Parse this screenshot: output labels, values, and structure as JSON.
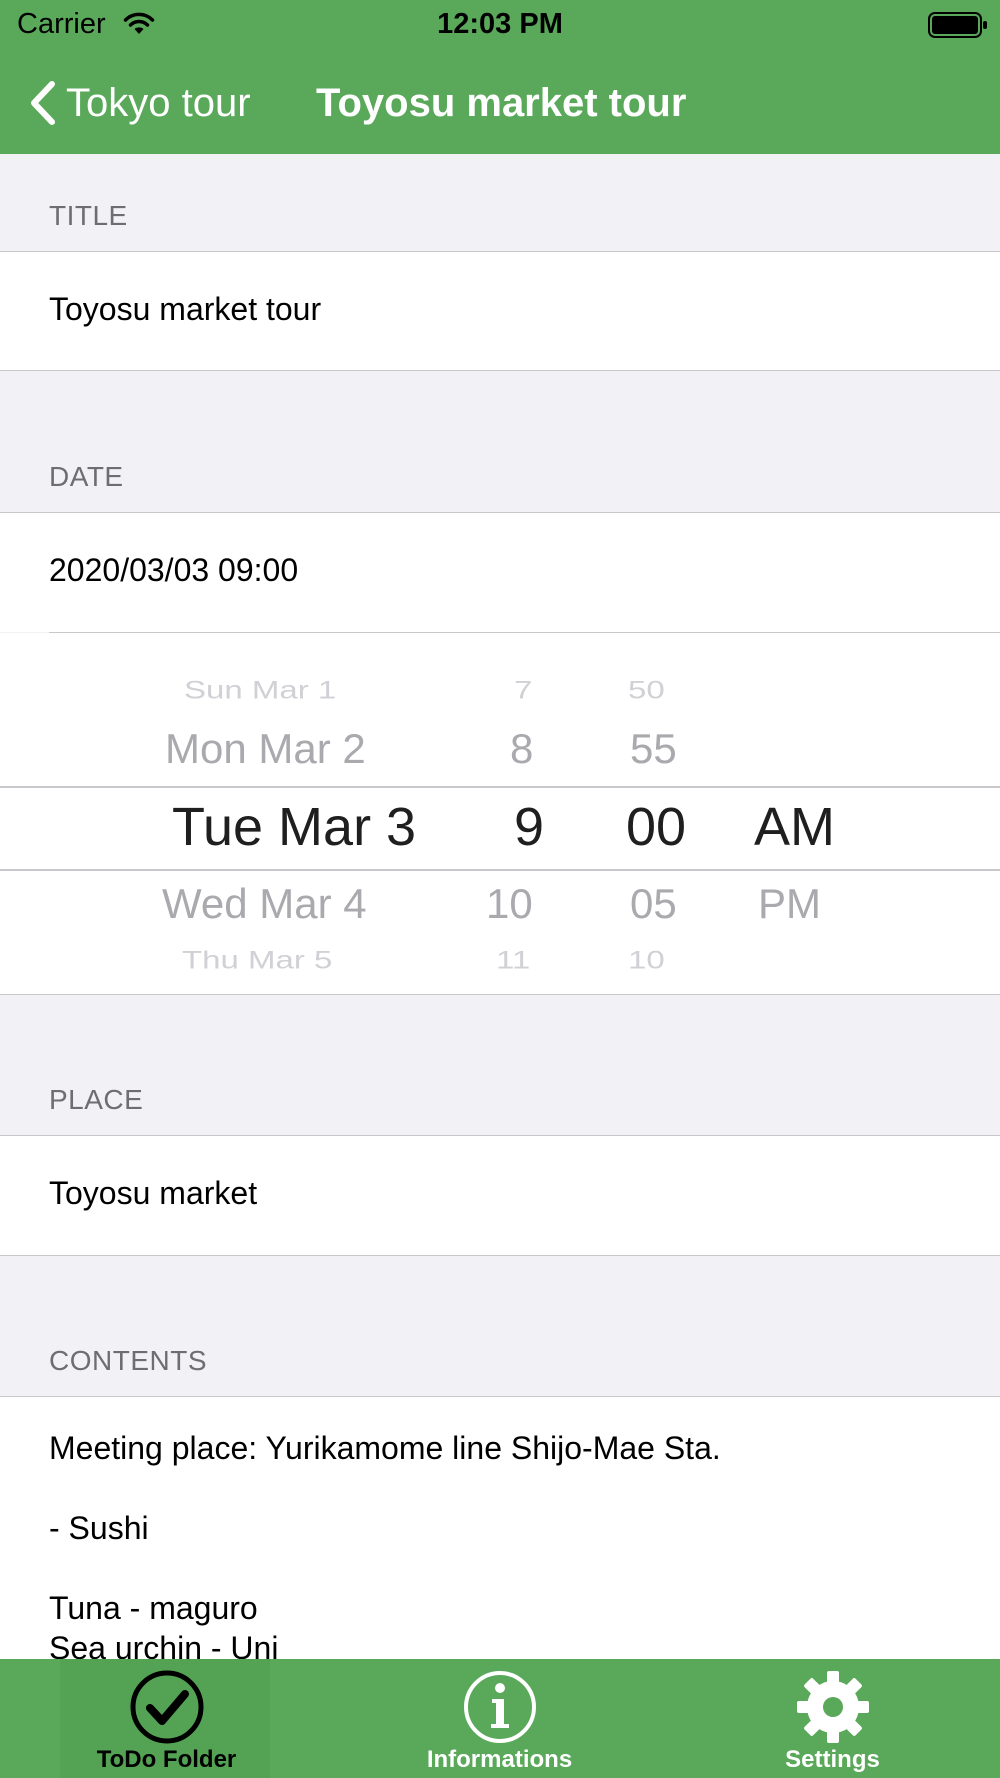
{
  "status_bar": {
    "carrier": "Carrier",
    "time": "12:03 PM"
  },
  "nav": {
    "back_label": "Tokyo tour",
    "title": "Toyosu market tour"
  },
  "colors": {
    "accent": "#5aa85a",
    "background": "#f1f1f6",
    "section_label": "#6d6d72",
    "selected_tab": "#000000",
    "unselected_tab": "#ffffff"
  },
  "sections": {
    "title": {
      "header": "TITLE",
      "value": "Toyosu market tour"
    },
    "date": {
      "header": "DATE",
      "value": "2020/03/03 09:00"
    },
    "place": {
      "header": "PLACE",
      "value": "Toyosu market"
    },
    "contents": {
      "header": "CONTENTS",
      "value": "Meeting place: Yurikamome line Shijo-Mae Sta.\n\n- Sushi\n\nTuna - maguro\nSea urchin - Uni"
    }
  },
  "picker": {
    "days": [
      "Sun Mar 1",
      "Mon Mar 2",
      "Tue Mar 3",
      "Wed Mar 4",
      "Thu Mar 5"
    ],
    "hours": [
      "7",
      "8",
      "9",
      "10",
      "11"
    ],
    "minutes": [
      "50",
      "55",
      "00",
      "05",
      "10"
    ],
    "ampm": [
      "AM",
      "PM"
    ],
    "selected": {
      "day": "Tue Mar 3",
      "hour": "9",
      "minute": "00",
      "ampm": "AM"
    }
  },
  "tabs": [
    {
      "label": "ToDo Folder",
      "icon": "checkmark-circle-icon",
      "selected": true
    },
    {
      "label": "Informations",
      "icon": "info-circle-icon",
      "selected": false
    },
    {
      "label": "Settings",
      "icon": "gear-icon",
      "selected": false
    }
  ]
}
